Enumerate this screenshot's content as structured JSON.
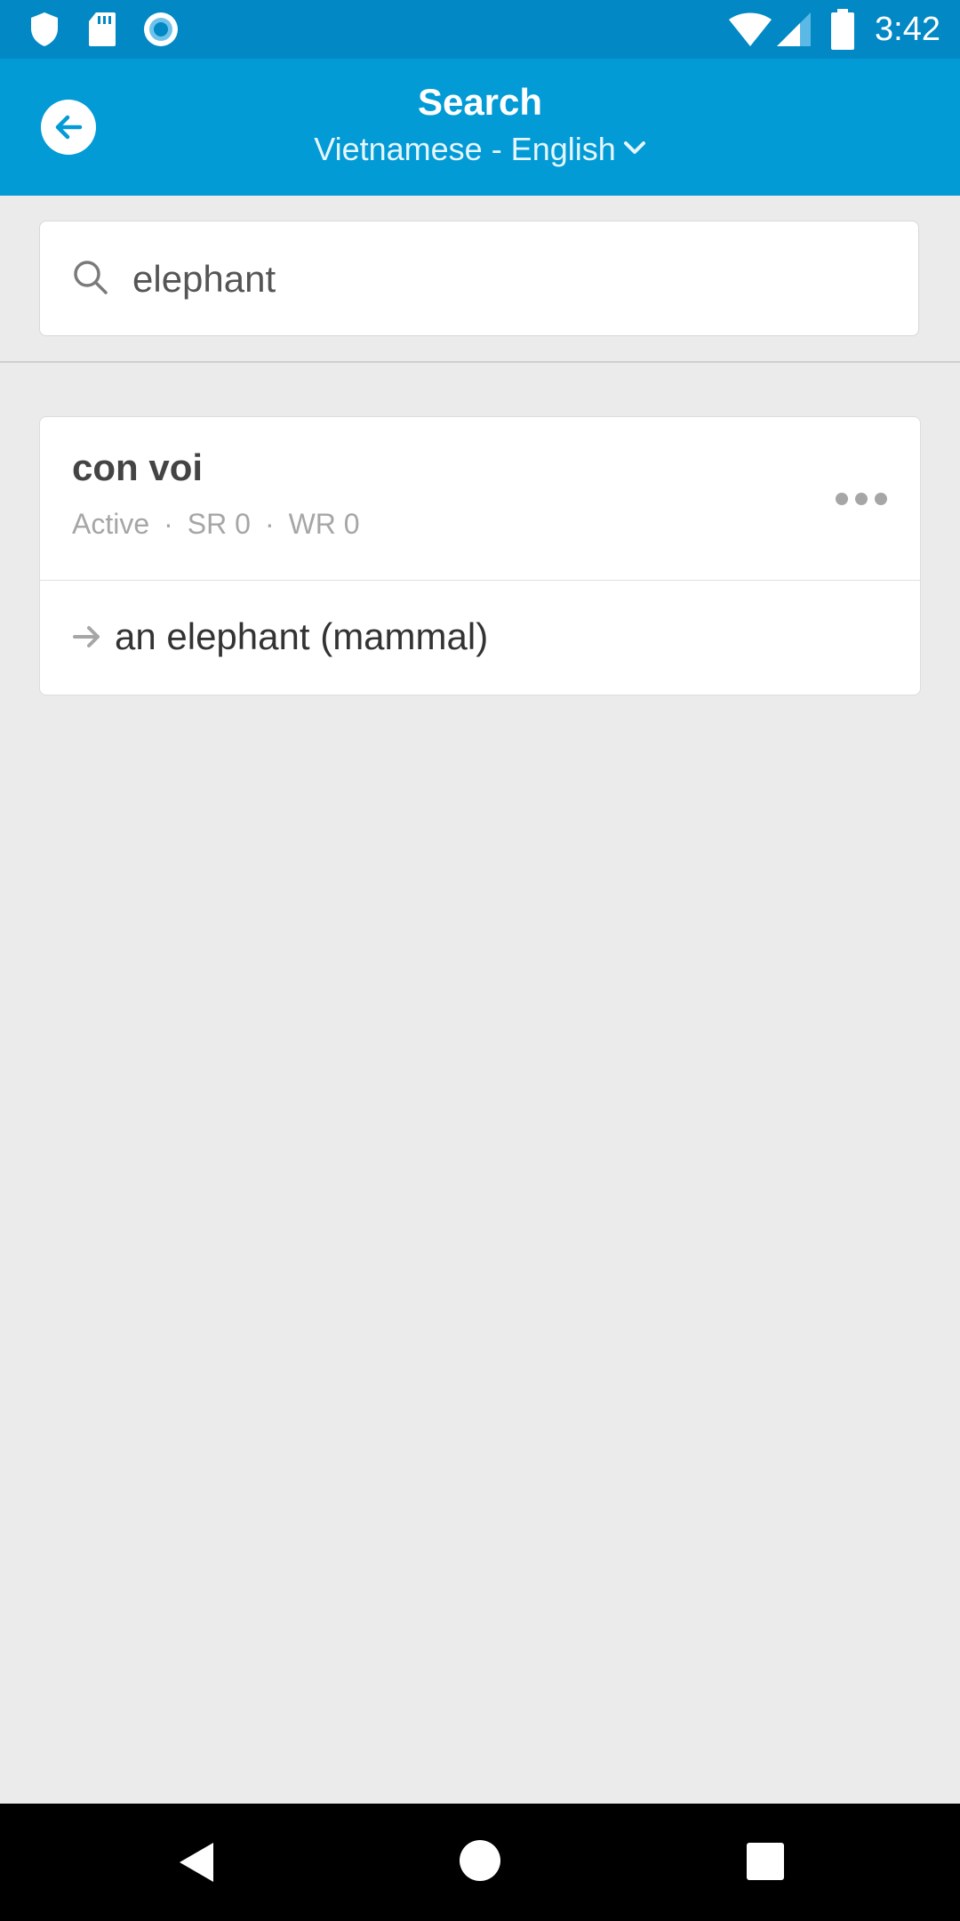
{
  "status_bar": {
    "time": "3:42",
    "icons": [
      "shield-icon",
      "sd-card-icon",
      "circle-notification-icon",
      "wifi-icon",
      "cell-signal-icon",
      "battery-icon"
    ]
  },
  "app_bar": {
    "title": "Search",
    "language_pair": "Vietnamese - English",
    "back_icon": "arrow-left-icon",
    "dropdown_icon": "chevron-down-icon"
  },
  "search": {
    "value": "elephant",
    "icon": "search-icon"
  },
  "results": [
    {
      "term": "con voi",
      "status": "Active",
      "sr": "SR 0",
      "wr": "WR 0",
      "separator": "·",
      "more_icon": "more-horizontal-icon",
      "translation": "an elephant (mammal)",
      "translation_icon": "arrow-right-icon"
    }
  ],
  "nav_bar": {
    "icons": [
      "back-triangle-icon",
      "home-circle-icon",
      "recents-square-icon"
    ]
  },
  "colors": {
    "status_bar": "#0288c4",
    "app_bar": "#039bd6",
    "background": "#ebebeb",
    "card": "#ffffff"
  }
}
